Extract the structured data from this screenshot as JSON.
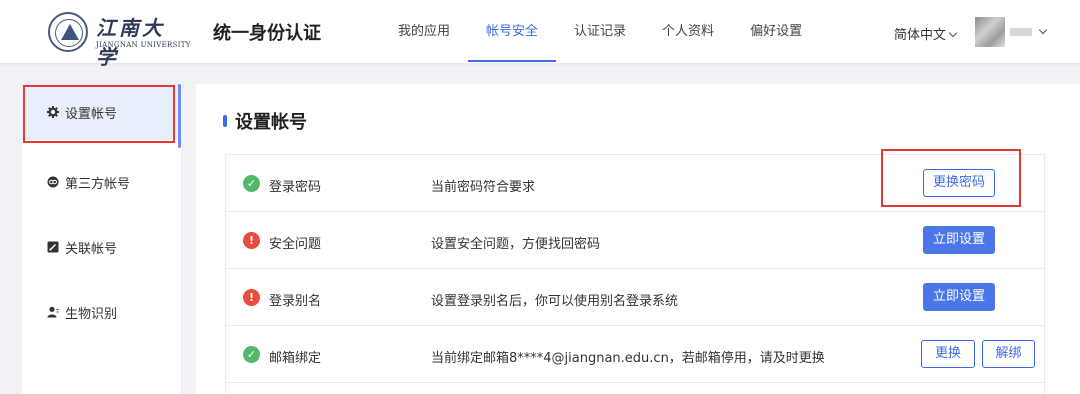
{
  "header": {
    "logo_cn": "江南大学",
    "logo_en": "JIANGNAN UNIVERSITY",
    "site_title": "统一身份认证",
    "nav": [
      {
        "label": "我的应用",
        "active": false
      },
      {
        "label": "帐号安全",
        "active": true
      },
      {
        "label": "认证记录",
        "active": false
      },
      {
        "label": "个人资料",
        "active": false
      },
      {
        "label": "偏好设置",
        "active": false
      }
    ],
    "language": "简体中文"
  },
  "sidebar": {
    "items": [
      {
        "label": "设置帐号",
        "icon": "gear-icon",
        "active": true
      },
      {
        "label": "第三方帐号",
        "icon": "link-icon",
        "active": false
      },
      {
        "label": "关联帐号",
        "icon": "edit-link-icon",
        "active": false
      },
      {
        "label": "生物识别",
        "icon": "user-icon",
        "active": false
      }
    ]
  },
  "main": {
    "section_title": "设置帐号",
    "rows": [
      {
        "name": "登录密码",
        "status": "ok",
        "desc": "当前密码符合要求",
        "buttons": [
          "更换密码"
        ]
      },
      {
        "name": "安全问题",
        "status": "warn",
        "desc": "设置安全问题，方便找回密码",
        "buttons": [
          "立即设置"
        ]
      },
      {
        "name": "登录别名",
        "status": "warn",
        "desc": "设置登录别名后，你可以使用别名登录系统",
        "buttons": [
          "立即设置"
        ]
      },
      {
        "name": "邮箱绑定",
        "status": "ok",
        "desc": "当前绑定邮箱8****4@jiangnan.edu.cn，若邮箱停用，请及时更换",
        "buttons": [
          "更换",
          "解绑"
        ]
      }
    ]
  },
  "colors": {
    "accent": "#3b6be5",
    "ok": "#52b96a",
    "warn": "#e74c3c",
    "highlight_box": "#e53935"
  }
}
